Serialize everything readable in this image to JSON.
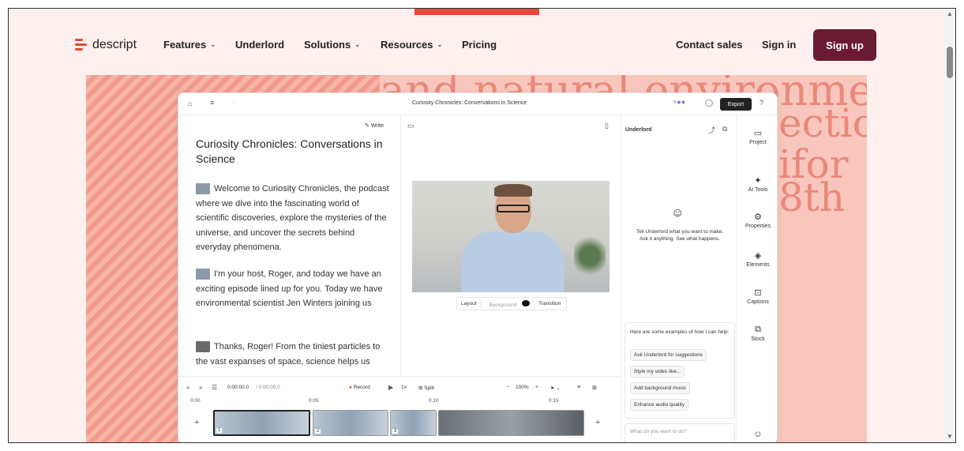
{
  "nav": {
    "logo": "descript",
    "items": [
      {
        "label": "Features",
        "has_menu": true
      },
      {
        "label": "Underlord",
        "has_menu": false
      },
      {
        "label": "Solutions",
        "has_menu": true
      },
      {
        "label": "Resources",
        "has_menu": true
      },
      {
        "label": "Pricing",
        "has_menu": false
      }
    ],
    "contact_sales": "Contact sales",
    "sign_in": "Sign in",
    "sign_up": "Sign up"
  },
  "hero": {
    "bg_text": [
      "and natural environment c",
      "ectio",
      "ifor",
      "8th"
    ]
  },
  "app": {
    "doc_title": "Curiosity Chronicles: Conversations in Science",
    "export": "Export",
    "write": "Write",
    "script_title": "Curiosity Chronicles: Conversations in Science",
    "paragraphs": [
      "Welcome to Curiosity Chronicles, the podcast where we dive into the fascinating world of scientific discoveries, explore the mysteries of the universe, and uncover the secrets behind everyday phenomena.",
      "I'm your host, Roger, and today we have an exciting episode lined up for you. Today we have environmental scientist Jen Winters joining us",
      "Thanks, Roger! From the tiniest particles to the vast expanses of space, science helps us"
    ],
    "preview_bar": {
      "layout": "Layout",
      "background": "Background",
      "transition": "Transition"
    },
    "underlord": {
      "title": "Underlord",
      "prompt": "Tell Underlord what you want to make. Ask it anything. See what happens.",
      "examples_heading": "Here are some examples of how I can help:",
      "chips": [
        "Ask Underlord for suggestions",
        "Style my video like...",
        "Add background music",
        "Enhance audio quality"
      ],
      "input_placeholder": "What do you want to do?"
    },
    "rail": [
      "Project",
      "AI Tools",
      "Properties",
      "Elements",
      "Captions",
      "Stock"
    ],
    "timeline": {
      "time": "0:00:00.0",
      "duration": "/ 0:00:00.0",
      "record": "Record",
      "speed": "1x",
      "split": "Split",
      "zoom": "100%",
      "ruler": [
        "0:00",
        "0:05",
        "0:10",
        "0:15"
      ],
      "clip_numbers": [
        "1",
        "2",
        "3"
      ]
    }
  }
}
